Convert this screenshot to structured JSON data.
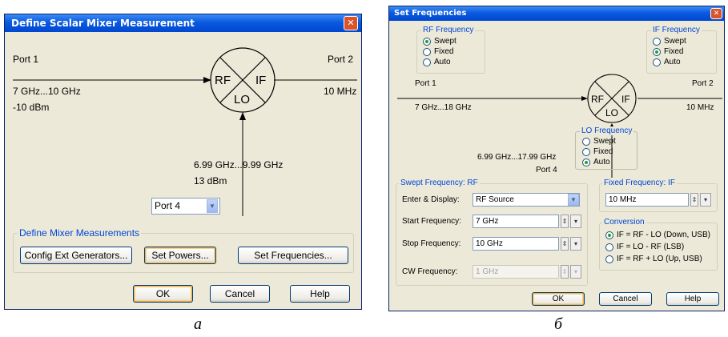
{
  "dialog_a": {
    "title": "Define Scalar Mixer Measurement",
    "close_glyph": "✕",
    "port1": "Port 1",
    "port2": "Port 2",
    "rf_freq": "7 GHz...10 GHz",
    "rf_power": "-10 dBm",
    "if_freq": "10 MHz",
    "lo_freq": "6.99 GHz...9.99 GHz",
    "lo_power": "13 dBm",
    "mixer_rf": "RF",
    "mixer_if": "IF",
    "mixer_lo": "LO",
    "port_select": "Port 4",
    "group_title": "Define Mixer Measurements",
    "btn_config": "Config Ext Generators...",
    "btn_powers": "Set Powers...",
    "btn_freqs": "Set Frequencies...",
    "btn_ok": "OK",
    "btn_cancel": "Cancel",
    "btn_help": "Help"
  },
  "dialog_b": {
    "title": "Set Frequencies",
    "rf_group": "RF Frequency",
    "rf_opts": [
      "Swept",
      "Fixed",
      "Auto"
    ],
    "rf_selected": "Swept",
    "if_group": "IF Frequency",
    "if_opts": [
      "Swept",
      "Fixed",
      "Auto"
    ],
    "if_selected": "Fixed",
    "port1": "Port 1",
    "port2": "Port 2",
    "rf_freq": "7 GHz...18 GHz",
    "if_freq": "10 MHz",
    "mixer_rf": "RF",
    "mixer_if": "IF",
    "mixer_lo": "LO",
    "lo_group": "LO Frequency",
    "lo_opts": [
      "Swept",
      "Fixed",
      "Auto"
    ],
    "lo_selected": "Auto",
    "lo_freq": "6.99 GHz...17.99 GHz",
    "lo_port": "Port 4",
    "swept_group": "Swept Frequency: RF",
    "enter_display_label": "Enter & Display:",
    "enter_display_value": "RF Source",
    "start_label": "Start Frequency:",
    "start_value": "7 GHz",
    "stop_label": "Stop Frequency:",
    "stop_value": "10 GHz",
    "cw_label": "CW Frequency:",
    "cw_value": "1 GHz",
    "fixed_group": "Fixed Frequency: IF",
    "fixed_value": "10 MHz",
    "conv_group": "Conversion",
    "conv_opts": [
      "IF = RF - LO (Down, USB)",
      "IF = LO - RF (LSB)",
      "IF = RF + LO (Up, USB)"
    ],
    "conv_selected": "IF = RF - LO (Down, USB)",
    "btn_ok": "OK",
    "btn_cancel": "Cancel",
    "btn_help": "Help"
  },
  "captions": {
    "a": "а",
    "b": "б"
  },
  "colors": {
    "titlebar": "#0a5ae0",
    "dialog_bg": "#ece9d8",
    "group_title": "#0046d5",
    "radio_on": "#21a121"
  }
}
